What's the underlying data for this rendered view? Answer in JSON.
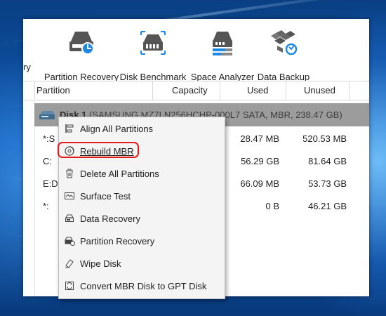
{
  "toolbar": {
    "cut_label": "ry",
    "items": [
      {
        "label": "Partition Recovery",
        "icon": "partition-recovery-icon"
      },
      {
        "label": "Disk Benchmark",
        "icon": "disk-benchmark-icon"
      },
      {
        "label": "Space Analyzer",
        "icon": "space-analyzer-icon"
      },
      {
        "label": "Data Backup",
        "icon": "data-backup-icon"
      }
    ]
  },
  "table": {
    "headers": {
      "partition": "Partition",
      "capacity": "Capacity",
      "used": "Used",
      "unused": "Unused"
    },
    "disk": {
      "name": "Disk 1",
      "detail": "(SAMSUNG MZ7LN256HCHP-000L7 SATA, MBR, 238.47 GB)"
    },
    "rows": [
      {
        "partition": "*:S",
        "used": "28.47 MB",
        "unused": "520.53 MB"
      },
      {
        "partition": "C:",
        "used": "56.29 GB",
        "unused": "81.64 GB"
      },
      {
        "partition": "E:D",
        "used": "66.09 MB",
        "unused": "53.73 GB"
      },
      {
        "partition": "*:",
        "used": "0 B",
        "unused": "46.21 GB"
      }
    ]
  },
  "context_menu": {
    "items": [
      {
        "label": "Align All Partitions",
        "icon": "align-partitions-icon"
      },
      {
        "label": "Rebuild MBR",
        "icon": "rebuild-mbr-icon",
        "highlighted": true
      },
      {
        "label": "Delete All Partitions",
        "icon": "trash-icon"
      },
      {
        "label": "Surface Test",
        "icon": "surface-test-icon"
      },
      {
        "label": "Data Recovery",
        "icon": "data-recovery-icon"
      },
      {
        "label": "Partition Recovery",
        "icon": "partition-recovery-small-icon"
      },
      {
        "label": "Wipe Disk",
        "icon": "eraser-icon"
      },
      {
        "label": "Convert MBR Disk to GPT Disk",
        "icon": "convert-disk-icon"
      }
    ],
    "highlight_color": "#e21a1a"
  },
  "colors": {
    "accent": "#1e88e5",
    "disk_row": "#9c9c9c",
    "desktop": "#0e59b4"
  }
}
